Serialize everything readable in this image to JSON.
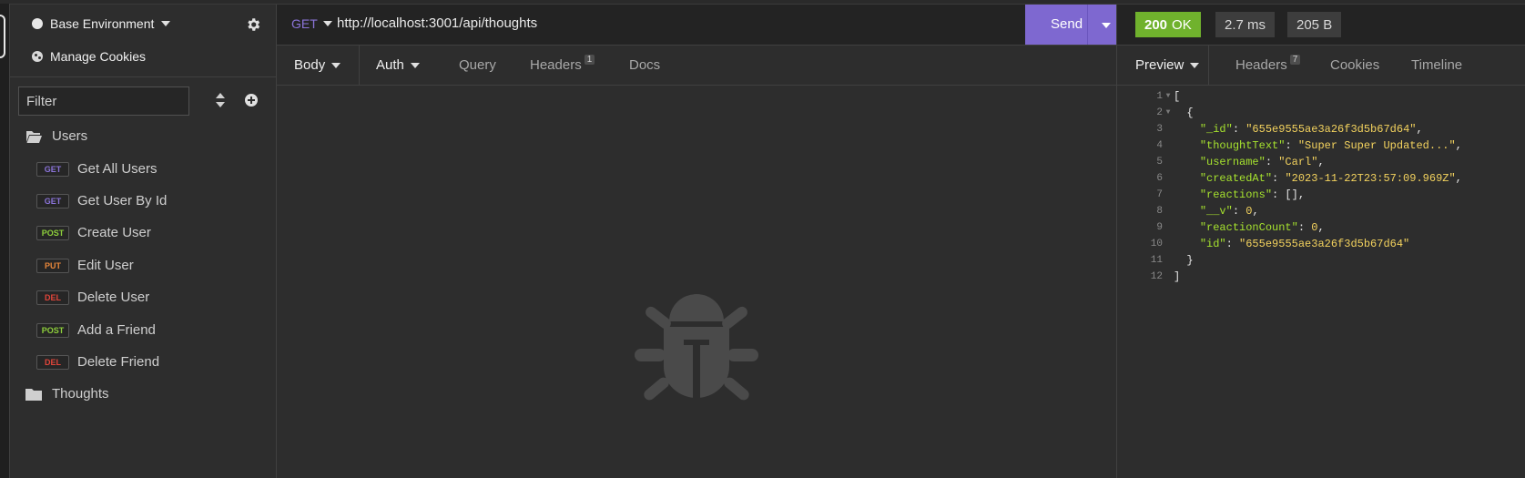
{
  "sidebar": {
    "environment": "Base Environment",
    "manage_cookies": "Manage Cookies",
    "filter_placeholder": "Filter",
    "folders": [
      {
        "label": "Users",
        "requests": [
          {
            "method": "GET",
            "label": "Get All Users"
          },
          {
            "method": "GET",
            "label": "Get User By Id"
          },
          {
            "method": "POST",
            "label": "Create User"
          },
          {
            "method": "PUT",
            "label": "Edit User"
          },
          {
            "method": "DEL",
            "label": "Delete User"
          },
          {
            "method": "POST",
            "label": "Add a Friend"
          },
          {
            "method": "DEL",
            "label": "Delete Friend"
          }
        ]
      },
      {
        "label": "Thoughts",
        "requests": []
      }
    ]
  },
  "request": {
    "method": "GET",
    "url": "http://localhost:3001/api/thoughts",
    "send_label": "Send",
    "tabs": {
      "body": "Body",
      "auth": "Auth",
      "query": "Query",
      "headers": "Headers",
      "headers_count": "1",
      "docs": "Docs"
    }
  },
  "response": {
    "status_code": "200",
    "status_text": "OK",
    "time": "2.7 ms",
    "size": "205 B",
    "tabs": {
      "preview": "Preview",
      "headers": "Headers",
      "headers_count": "7",
      "cookies": "Cookies",
      "timeline": "Timeline"
    },
    "body_lines": [
      "[",
      "  {",
      "    \"_id\": \"655e9555ae3a26f3d5b67d64\",",
      "    \"thoughtText\": \"Super Super Updated...\",",
      "    \"username\": \"Carl\",",
      "    \"createdAt\": \"2023-11-22T23:57:09.969Z\",",
      "    \"reactions\": [],",
      "    \"__v\": 0,",
      "    \"reactionCount\": 0,",
      "    \"id\": \"655e9555ae3a26f3d5b67d64\"",
      "  }",
      "]"
    ]
  },
  "colors": {
    "accent": "#7e68d0",
    "status_ok": "#70b22d",
    "get": "#8b74d9",
    "post": "#8ecf3c",
    "put": "#e8873a",
    "del": "#e0453a",
    "json_key": "#a6e22e",
    "json_value": "#f4d35e"
  },
  "icons": {
    "environment": "circle-icon",
    "cookies": "cookie-icon",
    "settings": "gear-icon",
    "sort": "sort-icon",
    "add": "plus-circle-icon",
    "folder_open": "folder-open-icon",
    "folder_closed": "folder-icon",
    "empty_state": "bug-icon"
  }
}
